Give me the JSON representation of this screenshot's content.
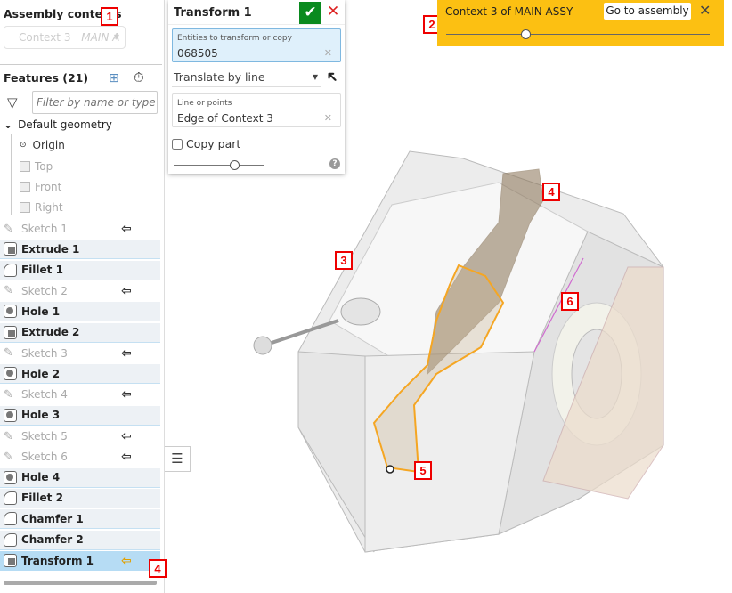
{
  "left_panel": {
    "assembly_contexts_title": "Assembly contexts",
    "context_select": {
      "value": "Context 3",
      "italic_hint": "MAIN A"
    },
    "features_title": "Features (21)",
    "filter_placeholder": "Filter by name or type",
    "default_geometry": "Default geometry",
    "geometry": [
      "Origin",
      "Top",
      "Front",
      "Right"
    ],
    "features": [
      {
        "label": "Sketch 1",
        "type": "sketch",
        "rollback": true
      },
      {
        "label": "Extrude 1",
        "type": "extrude"
      },
      {
        "label": "Fillet 1",
        "type": "fillet"
      },
      {
        "label": "Sketch 2",
        "type": "sketch",
        "rollback": true
      },
      {
        "label": "Hole 1",
        "type": "hole"
      },
      {
        "label": "Extrude 2",
        "type": "extrude"
      },
      {
        "label": "Sketch 3",
        "type": "sketch",
        "rollback": true
      },
      {
        "label": "Hole 2",
        "type": "hole"
      },
      {
        "label": "Sketch 4",
        "type": "sketch",
        "rollback": true
      },
      {
        "label": "Hole 3",
        "type": "hole"
      },
      {
        "label": "Sketch 5",
        "type": "sketch",
        "rollback": true
      },
      {
        "label": "Sketch 6",
        "type": "sketch",
        "rollback": true
      },
      {
        "label": "Hole 4",
        "type": "hole"
      },
      {
        "label": "Fillet 2",
        "type": "fillet"
      },
      {
        "label": "Chamfer 1",
        "type": "chamfer"
      },
      {
        "label": "Chamfer 2",
        "type": "chamfer"
      },
      {
        "label": "Transform 1",
        "type": "transform",
        "selected": true,
        "rollback": true
      }
    ]
  },
  "dialog": {
    "title": "Transform 1",
    "entities_label": "Entities to transform or copy",
    "entities_value": "068505",
    "mode": "Translate by line",
    "line_label": "Line or points",
    "line_value": "Edge of Context 3",
    "copy_part": "Copy part",
    "copy_part_checked": false,
    "slider_value_fraction": 0.67
  },
  "banner": {
    "title": "Context 3 of MAIN ASSY",
    "go_button": "Go to assembly",
    "slider_value_fraction": 0.3
  },
  "callouts": [
    "1",
    "2",
    "3",
    "4",
    "5",
    "6",
    "4"
  ],
  "colors": {
    "banner": "#fcc012",
    "confirm": "#0a8a1f",
    "selected_row": "#b6dcf4",
    "highlight": "#f5a623",
    "callout": "#e00000"
  }
}
